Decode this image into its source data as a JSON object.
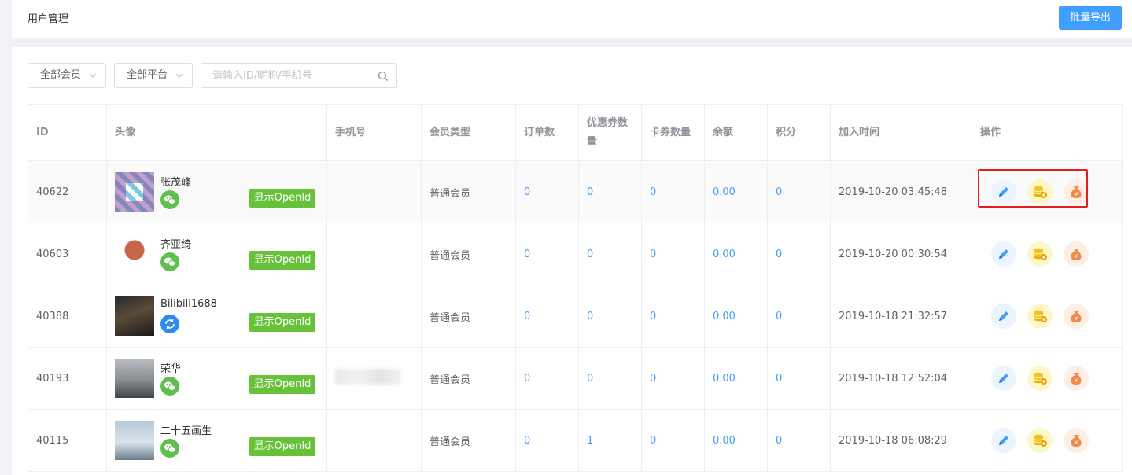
{
  "header": {
    "title": "用户管理",
    "export_label": "批量导出"
  },
  "filters": {
    "member_select": "全部会员",
    "platform_select": "全部平台",
    "search_placeholder": "请输入ID/昵称/手机号"
  },
  "table": {
    "columns": [
      "ID",
      "头像",
      "手机号",
      "会员类型",
      "订单数",
      "优惠券数量",
      "卡券数量",
      "余额",
      "积分",
      "加入时间",
      "操作"
    ],
    "openid_label": "显示OpenId",
    "rows": [
      {
        "id": "40622",
        "nickname": "张茂峰",
        "platform": "wechat-icon",
        "phone": "",
        "member_type": "普通会员",
        "orders": "0",
        "coupons": "0",
        "cards": "0",
        "balance": "0.00",
        "points": "0",
        "joined": "2019-10-20 03:45:48"
      },
      {
        "id": "40603",
        "nickname": "齐亚绮",
        "platform": "wechat-icon",
        "phone": "",
        "member_type": "普通会员",
        "orders": "0",
        "coupons": "0",
        "cards": "0",
        "balance": "0.00",
        "points": "0",
        "joined": "2019-10-20 00:30:54"
      },
      {
        "id": "40388",
        "nickname": "Bilibili1688",
        "platform": "sync-icon",
        "phone": "",
        "member_type": "普通会员",
        "orders": "0",
        "coupons": "0",
        "cards": "0",
        "balance": "0.00",
        "points": "0",
        "joined": "2019-10-18 21:32:57"
      },
      {
        "id": "40193",
        "nickname": "荣华",
        "platform": "wechat-icon",
        "phone": "",
        "member_type": "普通会员",
        "orders": "0",
        "coupons": "0",
        "cards": "0",
        "balance": "0.00",
        "points": "0",
        "joined": "2019-10-18 12:52:04"
      },
      {
        "id": "40115",
        "nickname": "二十五画生",
        "platform": "wechat-icon",
        "phone": "",
        "member_type": "普通会员",
        "orders": "0",
        "coupons": "1",
        "cards": "0",
        "balance": "0.00",
        "points": "0",
        "joined": "2019-10-18 06:08:29"
      }
    ]
  },
  "colors": {
    "primary": "#409eff",
    "openid_green": "#67c23a",
    "highlight_red": "#e02020"
  }
}
